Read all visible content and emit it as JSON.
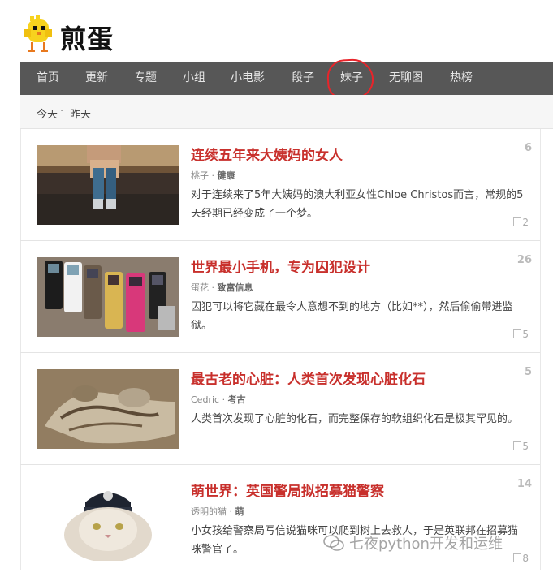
{
  "logo": {
    "text": "煎蛋"
  },
  "nav": {
    "items": [
      {
        "label": "首页"
      },
      {
        "label": "更新"
      },
      {
        "label": "专题"
      },
      {
        "label": "小组"
      },
      {
        "label": "小电影"
      },
      {
        "label": "段子"
      },
      {
        "label": "妹子"
      },
      {
        "label": "无聊图"
      },
      {
        "label": "热榜"
      }
    ],
    "annotated_item": "妹子",
    "annotation_color": "#e8242a"
  },
  "subbar": {
    "today": "今天",
    "sep": "·",
    "yesterday": "昨天"
  },
  "posts": [
    {
      "title": "连续五年来大姨妈的女人",
      "author": "桃子",
      "category": "健康",
      "excerpt": "对于连续来了5年大姨妈的澳大利亚女性Chloe Christos而言，常规的5天经期已经变成了一个梦。",
      "views": "6",
      "comments": "2"
    },
    {
      "title": "世界最小手机，专为囚犯设计",
      "author": "蛋花",
      "category": "致富信息",
      "excerpt": "囚犯可以将它藏在最令人意想不到的地方（比如**），然后偷偷带进监狱。",
      "views": "26",
      "comments": "5"
    },
    {
      "title": "最古老的心脏：人类首次发现心脏化石",
      "author": "Cedric",
      "category": "考古",
      "excerpt": "人类首次发现了心脏的化石，而完整保存的软组织化石是极其罕见的。",
      "views": "5",
      "comments": "5"
    },
    {
      "title": "萌世界：英国警局拟招募猫警察",
      "author": "透明的猫",
      "category": "萌",
      "excerpt": "小女孩给警察局写信说猫咪可以爬到树上去救人，于是英联邦在招募猫咪警官了。",
      "views": "14",
      "comments": "8"
    }
  ],
  "meta_sep": "·",
  "watermark": "七夜python开发和运维",
  "colors": {
    "nav_bg": "#575757",
    "title_red": "#c8302c"
  }
}
